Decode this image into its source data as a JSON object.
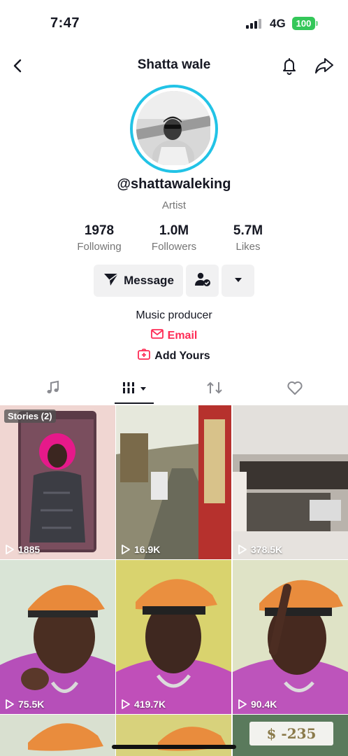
{
  "status_bar": {
    "time": "7:47",
    "network": "4G",
    "battery": "100"
  },
  "header": {
    "title": "Shatta wale",
    "icons": [
      "back-icon",
      "bell-icon",
      "share-icon"
    ]
  },
  "profile": {
    "username": "@shattawaleking",
    "category": "Artist",
    "stats": [
      {
        "value": "1978",
        "label": "Following"
      },
      {
        "value": "1.0M",
        "label": "Followers"
      },
      {
        "value": "5.7M",
        "label": "Likes"
      }
    ],
    "buttons": {
      "message": "Message"
    },
    "bio": "Music producer",
    "email_label": "Email",
    "add_yours_label": "Add Yours"
  },
  "tabs": [
    "music-icon",
    "grid-icon",
    "repost-icon",
    "heart-icon"
  ],
  "accent_color": "#fe2c55",
  "ring_color": "#22c3e6",
  "videos": [
    {
      "views": "1885",
      "badge": "Stories (2)"
    },
    {
      "views": "16.9K"
    },
    {
      "views": "378.5K"
    },
    {
      "views": "75.5K"
    },
    {
      "views": "419.7K"
    },
    {
      "views": "90.4K"
    }
  ],
  "bottom_row_text": "$ -235"
}
